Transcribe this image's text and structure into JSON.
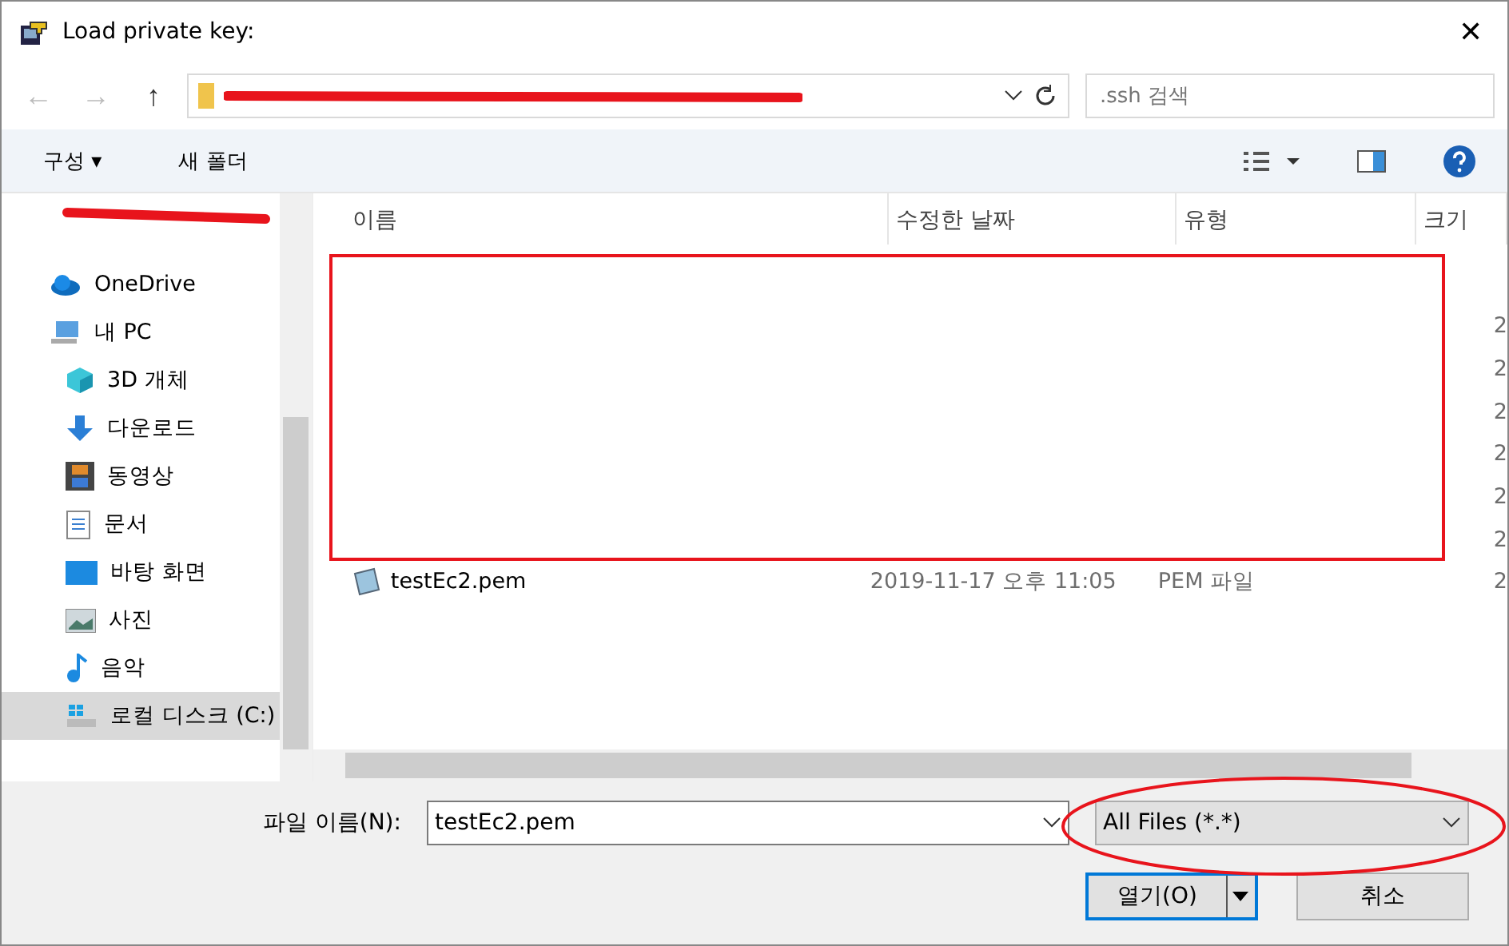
{
  "window": {
    "title": "Load private key:",
    "close": "✕"
  },
  "nav_buttons": [
    "←",
    "→",
    "↑"
  ],
  "search": {
    "placeholder": ".ssh 검색"
  },
  "toolbar": {
    "organize": "구성 ▾",
    "new_folder": "새 폴더"
  },
  "sidebar": {
    "items": [
      {
        "label": "OneDrive",
        "selected": false
      },
      {
        "label": "내 PC",
        "selected": false,
        "children": [
          {
            "label": "3D 개체",
            "selected": false
          },
          {
            "label": "다운로드",
            "selected": false
          },
          {
            "label": "동영상",
            "selected": false
          },
          {
            "label": "문서",
            "selected": false
          },
          {
            "label": "바탕 화면",
            "selected": false
          },
          {
            "label": "사진",
            "selected": false
          },
          {
            "label": "음악",
            "selected": false
          },
          {
            "label": "로컬 디스크 (C:)",
            "selected": true
          }
        ]
      }
    ]
  },
  "table": {
    "columns": [
      "이름",
      "수정한 날짜",
      "유형",
      "크기"
    ],
    "rows": [
      {
        "size": "2"
      },
      {
        "size": "2"
      },
      {
        "size": "2"
      },
      {
        "size": "2"
      },
      {
        "size": "2"
      },
      {
        "size": "2"
      },
      {
        "name": "testEc2.pem",
        "date": "2019-11-17 오후 11:05",
        "type": "PEM 파일",
        "size": "2"
      }
    ]
  },
  "footer": {
    "filename_label": "파일 이름(N):",
    "filename": "testEc2.pem",
    "filter": "All Files (*.*)",
    "open": "열기(O)",
    "cancel": "취소"
  }
}
